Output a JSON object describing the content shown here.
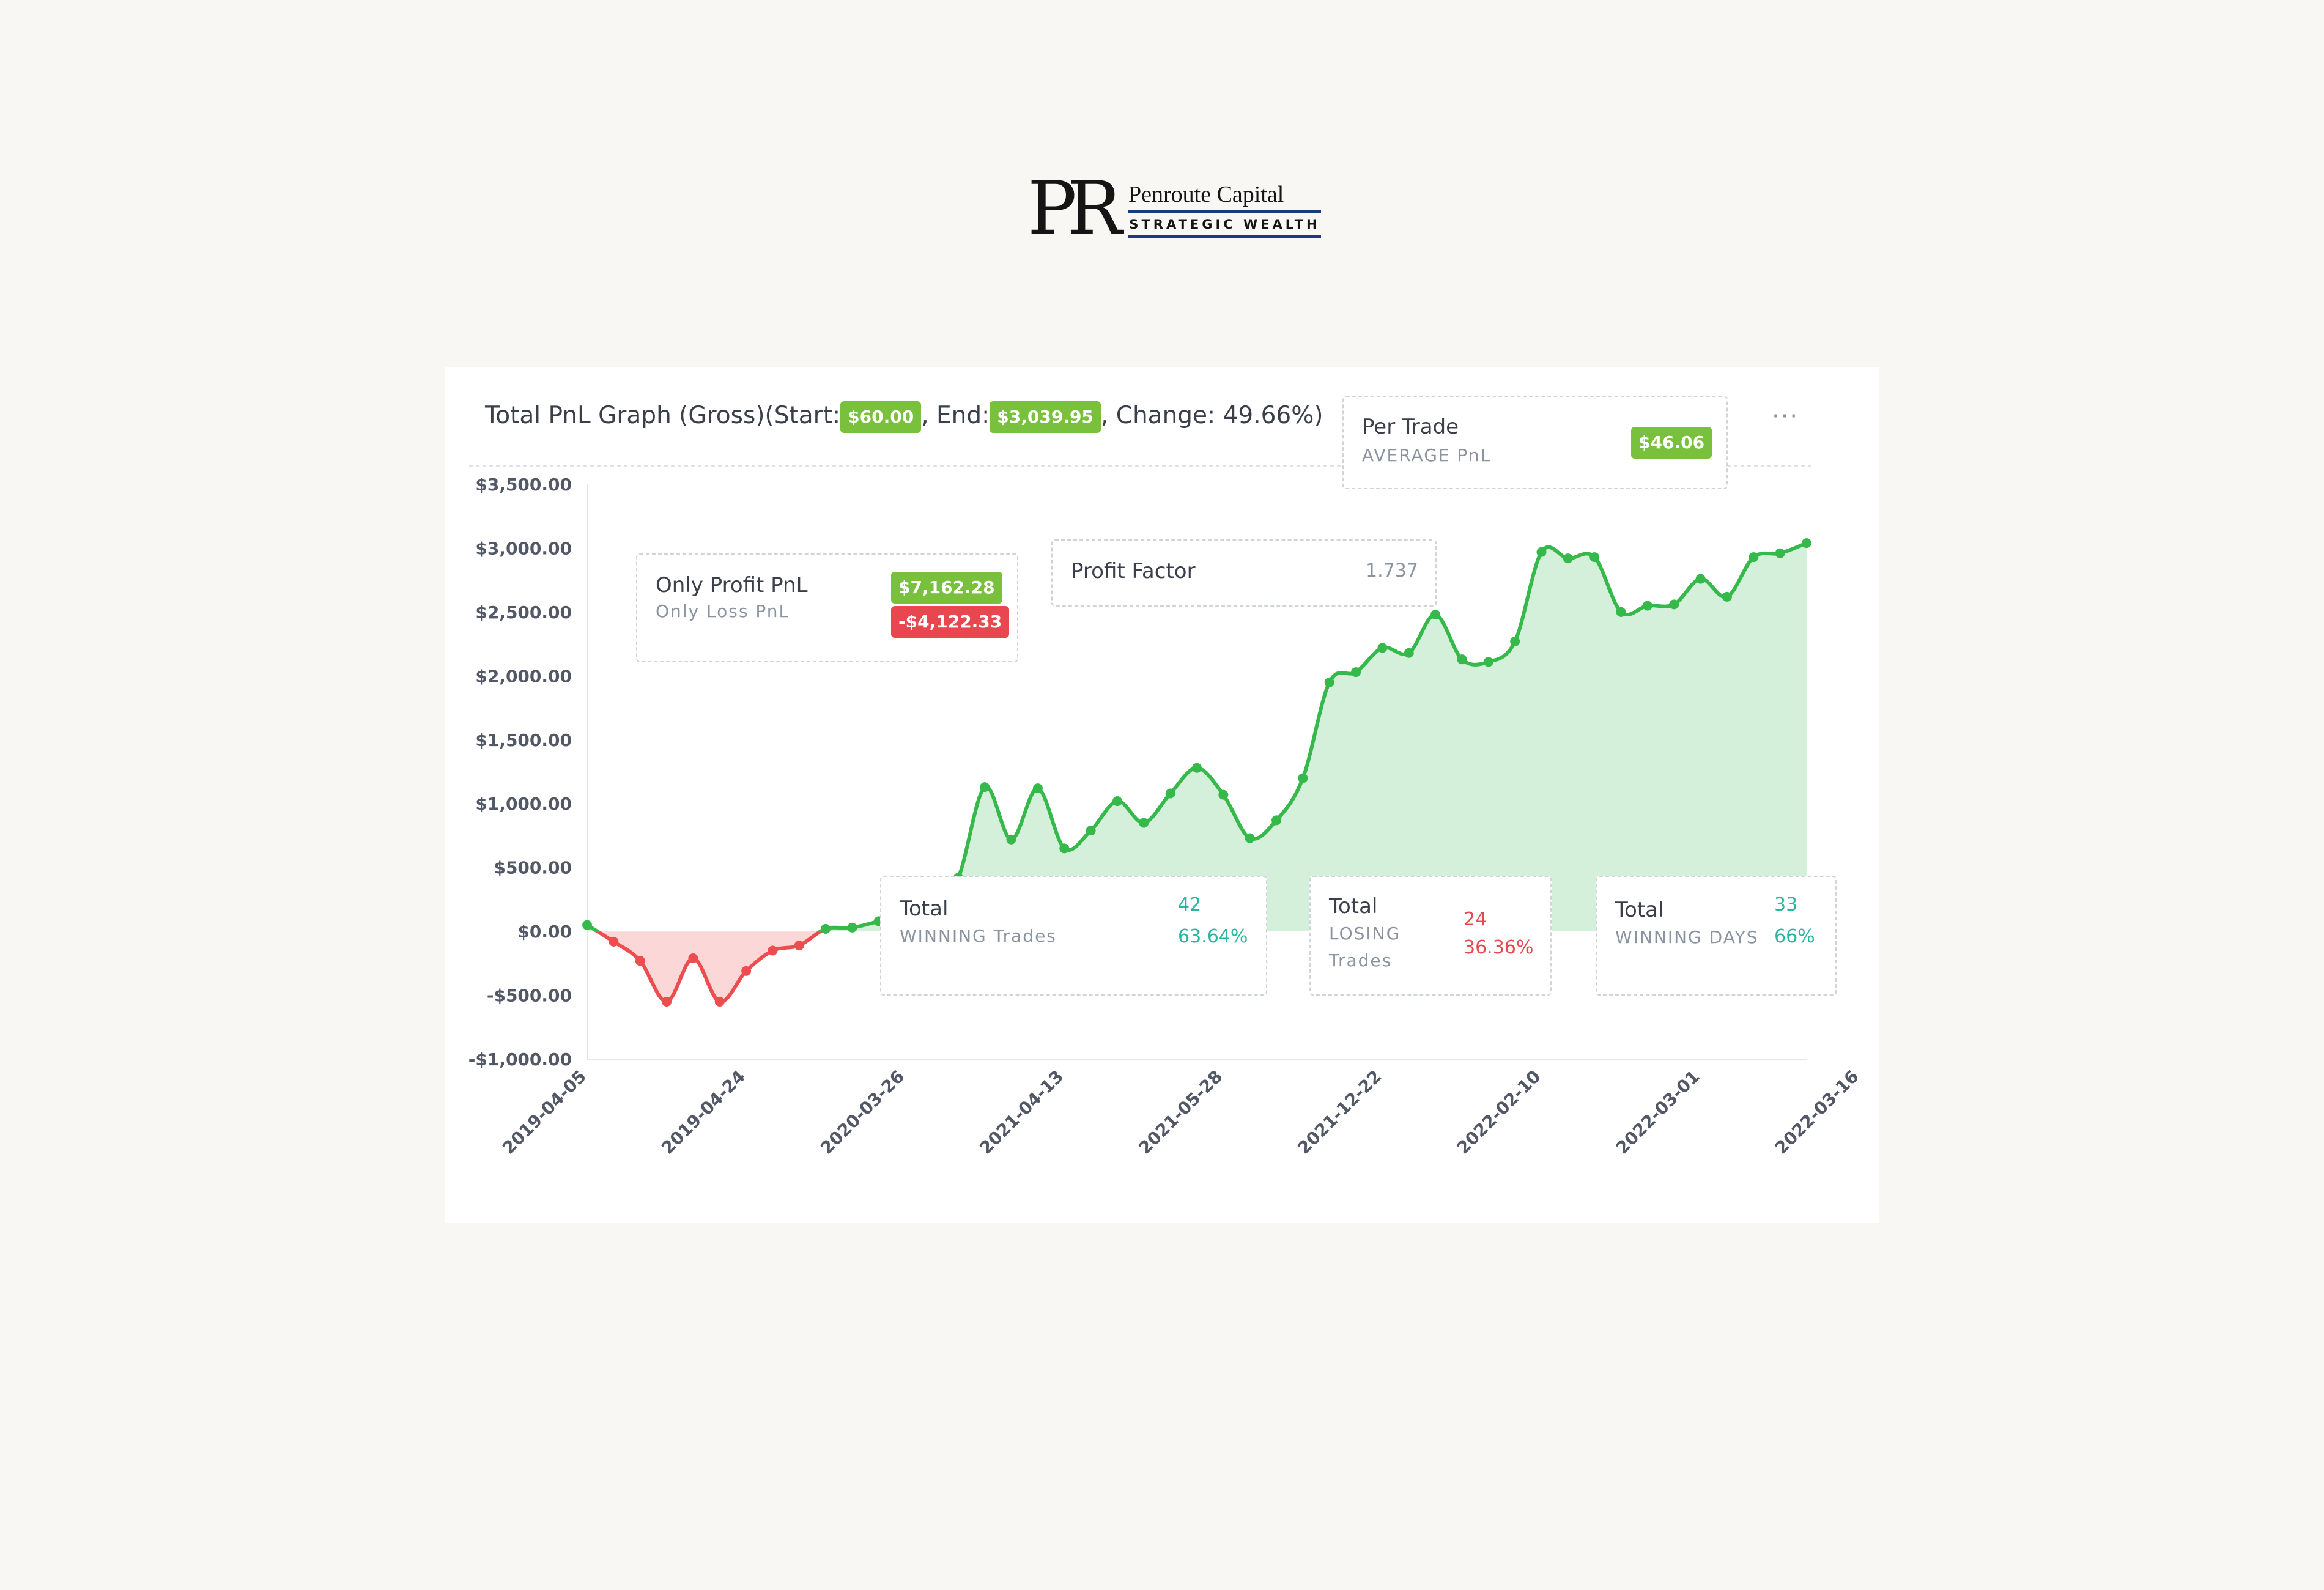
{
  "logo": {
    "monogram": "PR",
    "name": "Penroute Capital",
    "tagline": "STRATEGIC WEALTH"
  },
  "header": {
    "title_prefix": "Total PnL Graph (Gross)(Start:",
    "start_value": "$60.00",
    "end_label": ", End:",
    "end_value": "$3,039.95",
    "change_text": ", Change: 49.66%)",
    "menu": "···"
  },
  "stats": {
    "per_trade": {
      "title": "Per Trade",
      "subtitle": "AVERAGE PnL",
      "value": "$46.06"
    },
    "profit_loss": {
      "profit_label": "Only Profit PnL",
      "loss_label": "Only Loss PnL",
      "profit_value": "$7,162.28",
      "loss_value": "-$4,122.33"
    },
    "profit_factor": {
      "label": "Profit Factor",
      "value": "1.737"
    },
    "winning_trades": {
      "title": "Total",
      "subtitle": "WINNING Trades",
      "count": "42",
      "percent": "63.64%"
    },
    "losing_trades": {
      "title": "Total",
      "subtitle_line1": "LOSING",
      "subtitle_line2": "Trades",
      "count": "24",
      "percent": "36.36%"
    },
    "winning_days": {
      "title": "Total",
      "subtitle": "WINNING DAYS",
      "count": "33",
      "percent": "66%"
    }
  },
  "colors": {
    "positive": "#34b94a",
    "positive_fill": "#d5f0da",
    "negative": "#ee4d50",
    "negative_fill": "#fbd7d7",
    "badge_green": "#79c13c",
    "badge_red": "#e9474f"
  },
  "chart_data": {
    "type": "area",
    "title": "Total PnL Graph (Gross)",
    "ylim": [
      -1000,
      3500
    ],
    "yticks": [
      3500,
      3000,
      2500,
      2000,
      1500,
      1000,
      500,
      0,
      -500,
      -1000
    ],
    "ytick_labels": [
      "$3,500.00",
      "$3,000.00",
      "$2,500.00",
      "$2,000.00",
      "$1,500.00",
      "$1,000.00",
      "$500.00",
      "$0.00",
      "-$500.00",
      "-$1,000.00"
    ],
    "xtick_labels": [
      "2019-04-05",
      "2019-04-24",
      "2020-03-26",
      "2021-04-13",
      "2021-05-28",
      "2021-12-22",
      "2022-02-10",
      "2022-03-01",
      "2022-03-16"
    ],
    "xtick_positions": [
      0,
      6,
      12,
      18,
      24,
      30,
      36,
      42,
      48
    ],
    "grid": false,
    "series": [
      {
        "values": [
          50,
          -80,
          -230,
          -550,
          -210,
          -550,
          -310,
          -150,
          -110,
          20,
          30,
          80,
          140,
          180,
          420,
          1130,
          720,
          1120,
          650,
          790,
          1020,
          850,
          1080,
          1280,
          1070,
          730,
          870,
          1200,
          1950,
          2030,
          2220,
          2180,
          2480,
          2130,
          2110,
          2270,
          2970,
          2920,
          2930,
          2500,
          2550,
          2560,
          2760,
          2620,
          2930,
          2960,
          3040
        ]
      }
    ]
  }
}
